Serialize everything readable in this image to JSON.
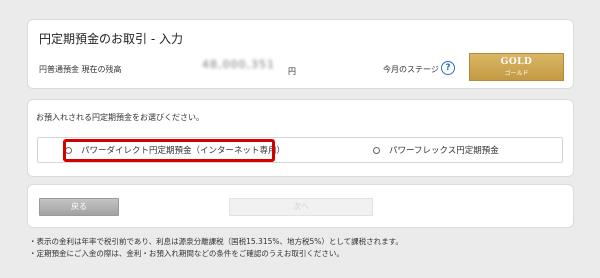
{
  "header": {
    "title": "円定期預金のお取引 - 入力",
    "balance_label": "円普通預金 現在の残高",
    "balance_value": "48,000,351",
    "balance_unit": "円",
    "stage_label": "今月のステージ",
    "help_icon": "?",
    "stage_badge": {
      "main": "GOLD",
      "sub": "ゴールド",
      "color": "#c9a24a"
    }
  },
  "selection": {
    "instruction": "お預入れされる円定期預金をお選びください。",
    "options": [
      {
        "label": "パワーダイレクト円定期預金（インターネット専用）",
        "selected": false
      },
      {
        "label": "パワーフレックス円定期預金",
        "selected": false
      }
    ],
    "highlight_color": "#d40000"
  },
  "actions": {
    "back_label": "戻る",
    "next_label": "次へ"
  },
  "notes": [
    "・表示の金利は年率で税引前であり、利息は源泉分離課税（国税15.315%、地方税5%）として課税されます。",
    "・定期預金にご入金の際は、金利・お預入れ期間などの条件をご確認のうえお取引ください。"
  ]
}
